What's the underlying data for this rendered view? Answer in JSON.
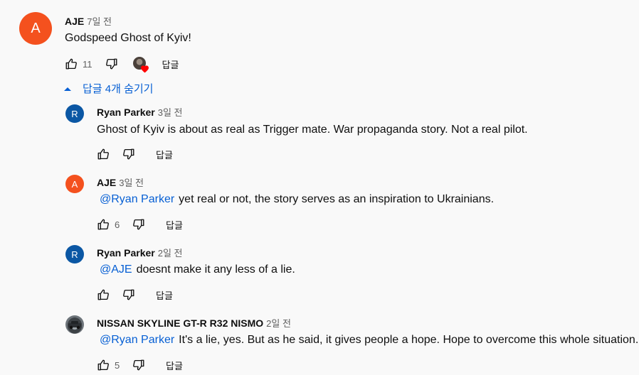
{
  "thread": {
    "author": "AJE",
    "avatar_letter": "A",
    "avatar_color": "#f4511e",
    "time": "7일 전",
    "text": "Godspeed Ghost of Kyiv!",
    "likes": "11",
    "reply_label": "답글",
    "hide_replies_label": "답글 4개 숨기기"
  },
  "replies": [
    {
      "author": "Ryan Parker",
      "avatar_letter": "R",
      "avatar_color": "#0b57a4",
      "time": "3일 전",
      "mention": "",
      "text": "Ghost of Kyiv is about as real as Trigger mate. War propaganda story. Not a real pilot.",
      "likes": "",
      "reply_label": "답글"
    },
    {
      "author": "AJE",
      "avatar_letter": "A",
      "avatar_color": "#f4511e",
      "time": "3일 전",
      "mention": "@Ryan Parker",
      "text": "yet real or not, the story serves as an inspiration to Ukrainians.",
      "likes": "6",
      "reply_label": "답글"
    },
    {
      "author": "Ryan Parker",
      "avatar_letter": "R",
      "avatar_color": "#0b57a4",
      "time": "2일 전",
      "mention": "@AJE",
      "text": "doesnt make it any less of a lie.",
      "likes": "",
      "reply_label": "답글"
    },
    {
      "author": "NISSAN SKYLINE GT-R R32 NISMO",
      "avatar_letter": "",
      "avatar_color": "#555555",
      "time": "2일 전",
      "mention": "@Ryan Parker",
      "text": "It's a lie, yes. But as he said, it gives people a hope. Hope to overcome this whole situation.",
      "likes": "5",
      "reply_label": "답글"
    }
  ],
  "icons": {
    "like": "thumbs-up-icon",
    "dislike": "thumbs-down-icon",
    "creator_heart": "creator-heart-icon",
    "chevron": "chevron-up-icon"
  },
  "colors": {
    "link": "#065fd4",
    "text": "#0f0f0f",
    "secondary": "#606060",
    "heart": "#ff0000"
  }
}
